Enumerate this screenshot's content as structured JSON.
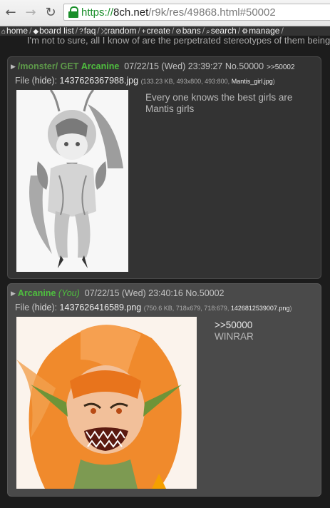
{
  "browser": {
    "url_scheme": "https://",
    "url_host": "8ch.net",
    "url_path": "/r9k/res/49868.html#50002"
  },
  "board_nav": [
    {
      "icon": "home-icon",
      "glyph": "⌂",
      "label": "home"
    },
    {
      "icon": "tag-icon",
      "glyph": "◆",
      "label": "board list"
    },
    {
      "icon": "question-icon",
      "glyph": "?",
      "label": "faq"
    },
    {
      "icon": "shuffle-icon",
      "glyph": "⤮",
      "label": "random"
    },
    {
      "icon": "plus-icon",
      "glyph": "+",
      "label": "create"
    },
    {
      "icon": "ban-icon",
      "glyph": "⊘",
      "label": "bans"
    },
    {
      "icon": "search-icon",
      "glyph": "⌕",
      "label": "search"
    },
    {
      "icon": "gear-icon",
      "glyph": "⚙",
      "label": "manage"
    }
  ],
  "partial_text": "I'm not to sure, all I know of are the perpetrated stereotypes of them being",
  "posts": [
    {
      "subject": "/monster/ GET",
      "name": "Arcanine",
      "you": "",
      "datetime": "07/22/15 (Wed) 23:39:27",
      "no": "No.50000",
      "backlink": ">>50002",
      "file_label": "File",
      "hide": "hide",
      "filename": "1437626367988.jpg",
      "filemeta": "(133.23 KB, 493x800, 493:800,",
      "original_name": "Mantis_girl.jpg",
      "body_lines": [
        "Every one knows the best girls are",
        "Mantis girls"
      ]
    },
    {
      "subject": "",
      "name": "Arcanine",
      "you": "(You)",
      "datetime": "07/22/15 (Wed) 23:40:16",
      "no": "No.50002",
      "backlink": "",
      "file_label": "File",
      "hide": "hide",
      "filename": "1437626416589.png",
      "filemeta": "(750.6 KB, 718x679, 718:679,",
      "original_name": "1426812539007.png",
      "quote": ">>50000",
      "body_lines": [
        "WINRAR"
      ]
    }
  ]
}
